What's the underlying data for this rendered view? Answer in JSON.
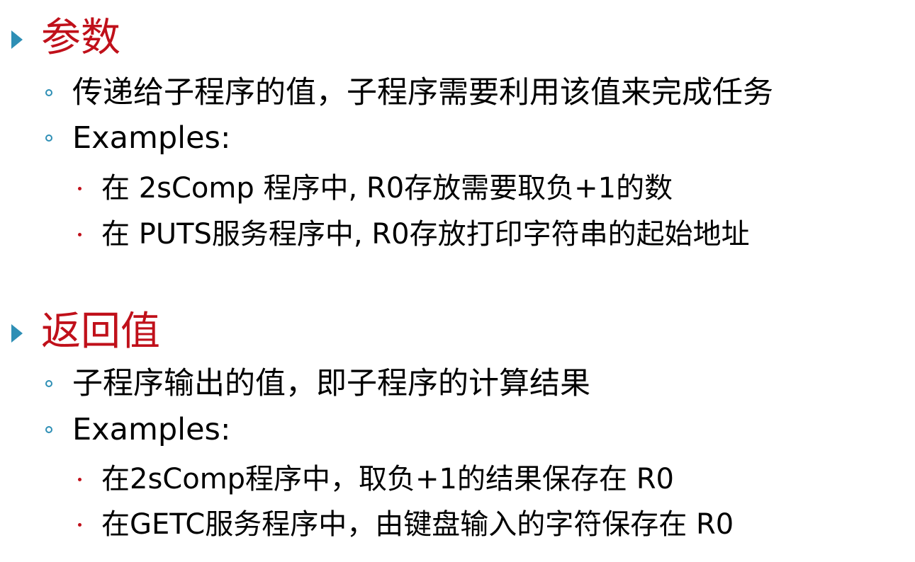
{
  "sections": [
    {
      "title": "参数",
      "items": [
        {
          "text": "传递给子程序的值，子程序需要利用该值来完成任务",
          "sub": []
        },
        {
          "text": "Examples:",
          "sub": [
            "在 2sComp 程序中, R0存放需要取负+1的数",
            "在 PUTS服务程序中, R0存放打印字符串的起始地址"
          ]
        }
      ]
    },
    {
      "title": "返回值",
      "items": [
        {
          "text": "子程序输出的值，即子程序的计算结果",
          "sub": []
        },
        {
          "text": "Examples:",
          "sub": [
            "在2sComp程序中，取负+1的结果保存在 R0",
            "在GETC服务程序中，由键盘输入的字符保存在 R0"
          ]
        }
      ]
    }
  ],
  "colors": {
    "title": "#c0101a",
    "bullet_primary": "#2e8fb5",
    "bullet_secondary": "#c0101a",
    "text": "#000000"
  },
  "icons": {
    "level1_bullet": "triangle-right-icon",
    "level2_bullet": "hollow-circle-icon",
    "level3_bullet": "dot-icon"
  }
}
